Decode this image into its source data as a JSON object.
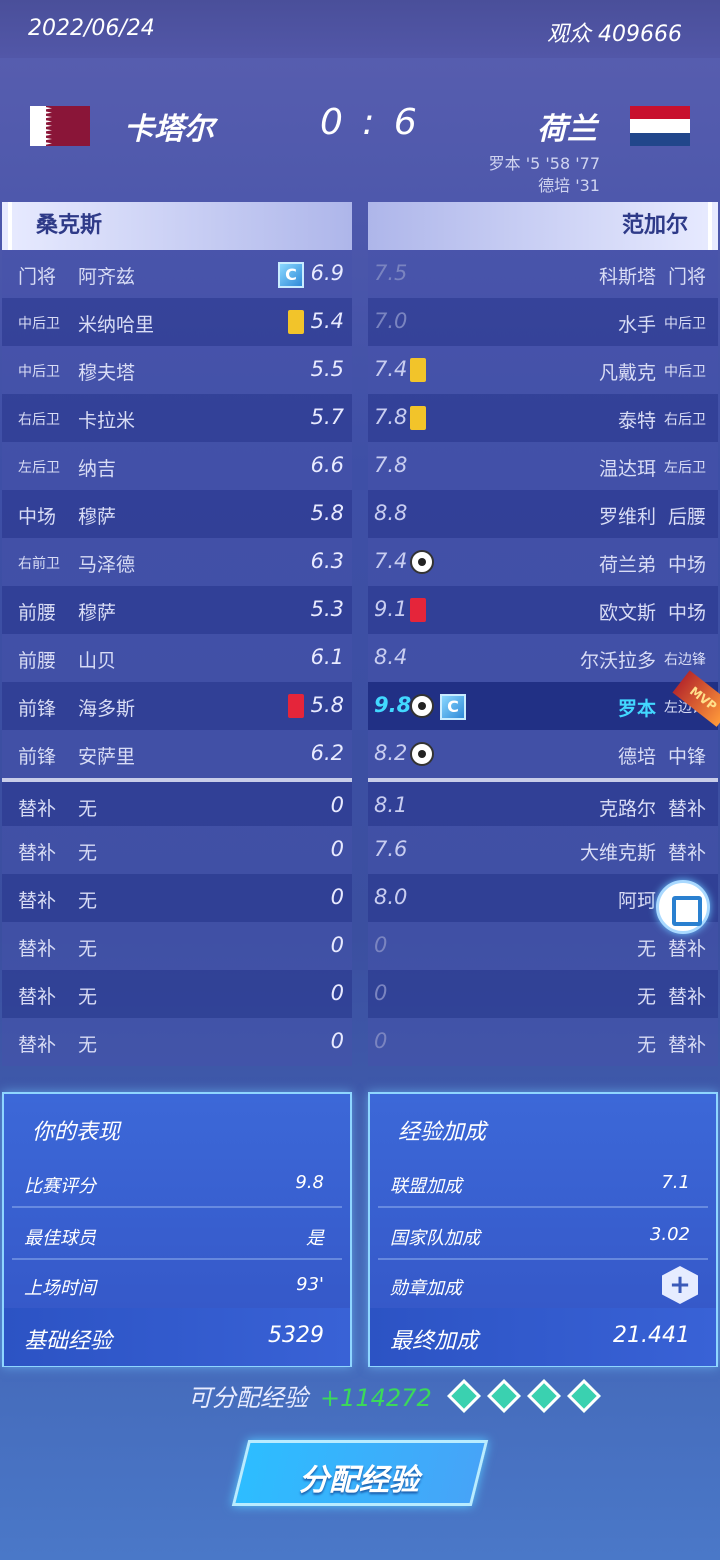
{
  "header": {
    "date": "2022/06/24",
    "audience": "观众 409666"
  },
  "match": {
    "home": "卡塔尔",
    "away": "荷兰",
    "score": "0 : 6",
    "scorers_line1": "罗本 '5  '58  '77",
    "scorers_line2": "德培 '31"
  },
  "colors": {
    "accent": "#2dbdff",
    "positive": "#3bd95a",
    "mvp": "#42d8ff",
    "yellow_card": "#f2c42a",
    "red_card": "#e5253a"
  },
  "home_lineup": {
    "coach": "桑克斯",
    "players": [
      {
        "pos": "门将",
        "name": "阿齐兹",
        "rating": "6.9",
        "icons": [
          "captain-icon"
        ]
      },
      {
        "pos": "中后卫",
        "name": "米纳哈里",
        "rating": "5.4",
        "icons": [
          "yellow-card-icon"
        ]
      },
      {
        "pos": "中后卫",
        "name": "穆夫塔",
        "rating": "5.5",
        "icons": []
      },
      {
        "pos": "右后卫",
        "name": "卡拉米",
        "rating": "5.7",
        "icons": []
      },
      {
        "pos": "左后卫",
        "name": "纳吉",
        "rating": "6.6",
        "icons": []
      },
      {
        "pos": "中场",
        "name": "穆萨",
        "rating": "5.8",
        "icons": []
      },
      {
        "pos": "右前卫",
        "name": "马泽德",
        "rating": "6.3",
        "icons": []
      },
      {
        "pos": "前腰",
        "name": "穆萨",
        "rating": "5.3",
        "icons": []
      },
      {
        "pos": "前腰",
        "name": "山贝",
        "rating": "6.1",
        "icons": []
      },
      {
        "pos": "前锋",
        "name": "海多斯",
        "rating": "5.8",
        "icons": [
          "red-card-icon"
        ]
      },
      {
        "pos": "前锋",
        "name": "安萨里",
        "rating": "6.2",
        "icons": []
      }
    ],
    "subs": [
      {
        "pos": "替补",
        "name": "无",
        "rating": "0"
      },
      {
        "pos": "替补",
        "name": "无",
        "rating": "0"
      },
      {
        "pos": "替补",
        "name": "无",
        "rating": "0"
      },
      {
        "pos": "替补",
        "name": "无",
        "rating": "0"
      },
      {
        "pos": "替补",
        "name": "无",
        "rating": "0"
      },
      {
        "pos": "替补",
        "name": "无",
        "rating": "0"
      }
    ]
  },
  "away_lineup": {
    "coach": "范加尔",
    "players": [
      {
        "pos": "门将",
        "name": "科斯塔",
        "rating": "7.5",
        "icons": []
      },
      {
        "pos": "中后卫",
        "name": "水手",
        "rating": "7.0",
        "icons": []
      },
      {
        "pos": "中后卫",
        "name": "凡戴克",
        "rating": "7.4",
        "icons": [
          "yellow-card-icon"
        ]
      },
      {
        "pos": "右后卫",
        "name": "泰特",
        "rating": "7.8",
        "icons": [
          "yellow-card-icon"
        ]
      },
      {
        "pos": "左后卫",
        "name": "温达珥",
        "rating": "7.8",
        "icons": []
      },
      {
        "pos": "后腰",
        "name": "罗维利",
        "rating": "8.8",
        "icons": []
      },
      {
        "pos": "中场",
        "name": "荷兰弟",
        "rating": "7.4",
        "icons": [
          "ball-icon"
        ]
      },
      {
        "pos": "中场",
        "name": "欧文斯",
        "rating": "9.1",
        "icons": [
          "red-card-icon"
        ]
      },
      {
        "pos": "右边锋",
        "name": "尔沃拉多",
        "rating": "8.4",
        "icons": []
      },
      {
        "pos": "左边锋",
        "name": "罗本",
        "rating": "9.8",
        "icons": [
          "multi-ball-icon",
          "captain-icon"
        ],
        "mvp": true
      },
      {
        "pos": "中锋",
        "name": "德培",
        "rating": "8.2",
        "icons": [
          "ball-icon"
        ]
      }
    ],
    "subs": [
      {
        "pos": "替补",
        "name": "克路尔",
        "rating": "8.1"
      },
      {
        "pos": "替补",
        "name": "大维克斯",
        "rating": "7.6"
      },
      {
        "pos": "替补",
        "name": "阿珂",
        "rating": "8.0"
      },
      {
        "pos": "替补",
        "name": "无",
        "rating": "0"
      },
      {
        "pos": "替补",
        "name": "无",
        "rating": "0"
      },
      {
        "pos": "替补",
        "name": "无",
        "rating": "0"
      }
    ],
    "mvp_badge": "MVP",
    "captain_label": "C"
  },
  "performance": {
    "title": "你的表现",
    "rows": [
      {
        "label": "比赛评分",
        "value": "9.8"
      },
      {
        "label": "最佳球员",
        "value": "是"
      },
      {
        "label": "上场时间",
        "value": "93'"
      }
    ],
    "footer_label": "基础经验",
    "footer_value": "5329"
  },
  "bonus": {
    "title": "经验加成",
    "rows": [
      {
        "label": "联盟加成",
        "value": "7.1"
      },
      {
        "label": "国家队加成",
        "value": "3.02"
      },
      {
        "label": "勋章加成",
        "value": "+"
      }
    ],
    "footer_label": "最终加成",
    "footer_value": "21.441"
  },
  "allocation": {
    "label": "可分配经验",
    "value": "+114272",
    "gem_count": 4
  },
  "cta": {
    "label": "分配经验"
  }
}
